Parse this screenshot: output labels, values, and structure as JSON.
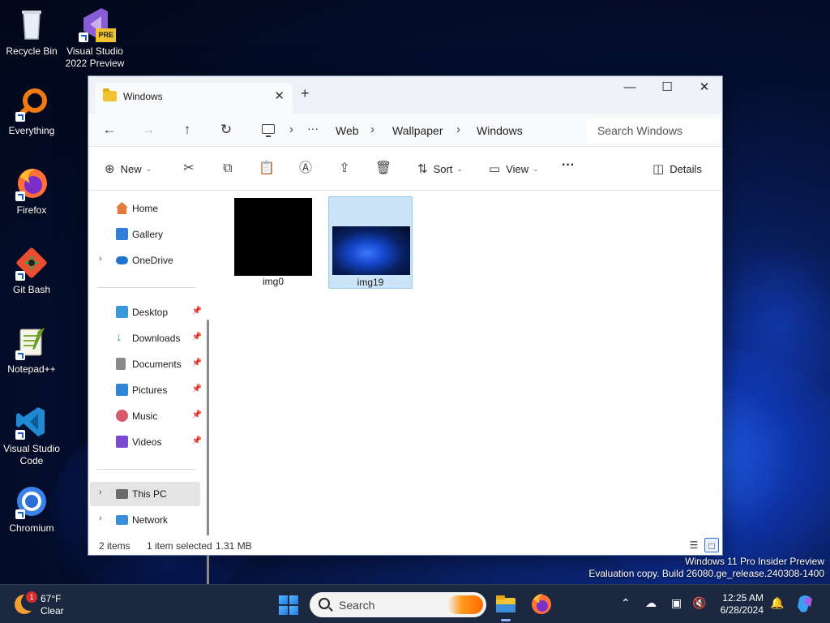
{
  "desktop": {
    "icons": [
      {
        "label": "Recycle Bin"
      },
      {
        "label": "Visual Studio 2022 Preview",
        "badge": "PRE"
      },
      {
        "label": "Everything"
      },
      {
        "label": "Firefox"
      },
      {
        "label": "Git Bash"
      },
      {
        "label": "Notepad++"
      },
      {
        "label": "Visual Studio Code"
      },
      {
        "label": "Chromium"
      }
    ],
    "watermark": {
      "line1": "Windows 11 Pro Insider Preview",
      "line2": "Evaluation copy. Build 26080.ge_release.240308-1400"
    }
  },
  "explorer": {
    "tab_title": "Windows",
    "tab_close": "✕",
    "new_tab": "+",
    "controls": {
      "minimize": "—",
      "maximize": "☐",
      "close": "✕"
    },
    "nav": {
      "back": "←",
      "forward": "→",
      "up": "↑",
      "refresh": "↻"
    },
    "breadcrumb": {
      "more": "···",
      "items": [
        "Web",
        "Wallpaper",
        "Windows"
      ],
      "sep": "›"
    },
    "search_placeholder": "Search Windows",
    "commands": {
      "new": "New",
      "sort": "Sort",
      "view": "View",
      "more": "···",
      "details": "Details"
    },
    "sidebar": {
      "items": [
        {
          "label": "Home",
          "color": "#e07b39"
        },
        {
          "label": "Gallery",
          "color": "#2f80d6"
        },
        {
          "label": "OneDrive",
          "color": "#1f74d0"
        },
        {
          "label": "Desktop",
          "color": "#3a9ad9"
        },
        {
          "label": "Downloads",
          "color": "#2e9e6a"
        },
        {
          "label": "Documents",
          "color": "#8a8a8a"
        },
        {
          "label": "Pictures",
          "color": "#2f86d8"
        },
        {
          "label": "Music",
          "color": "#d8586c"
        },
        {
          "label": "Videos",
          "color": "#7a4bd0"
        },
        {
          "label": "This PC",
          "color": "#6b6b6b"
        },
        {
          "label": "Network",
          "color": "#3a8fd8"
        }
      ]
    },
    "files": [
      {
        "name": "img0",
        "selected": false
      },
      {
        "name": "img19",
        "selected": true
      }
    ],
    "status": {
      "count": "2 items",
      "selection": "1 item selected",
      "size": "1.31 MB"
    }
  },
  "taskbar": {
    "weather": {
      "badge": "1",
      "temp": "67°F",
      "condition": "Clear"
    },
    "search_label": "Search",
    "clock": {
      "time": "12:25 AM",
      "date": "6/28/2024"
    },
    "accent": "#8ab4f8"
  }
}
